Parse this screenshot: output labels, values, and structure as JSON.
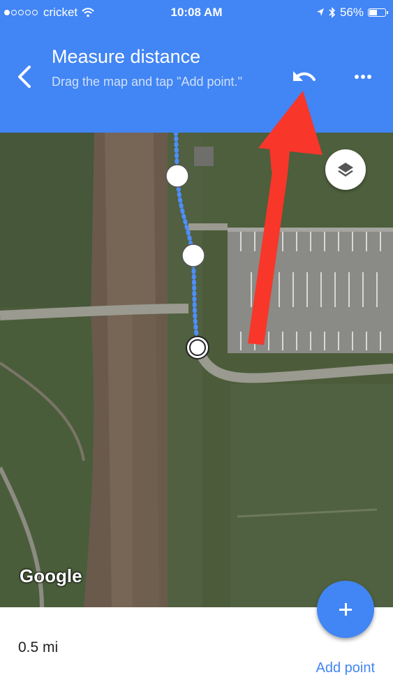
{
  "status_bar": {
    "carrier": "cricket",
    "time": "10:08 AM",
    "battery": "56%",
    "battery_level": 0.56,
    "signal_bars": 1,
    "icons": [
      "wifi-icon",
      "location-icon",
      "bluetooth-icon",
      "battery-icon"
    ]
  },
  "header": {
    "title": "Measure distance",
    "subtitle": "Drag the map and tap \"Add point.\"",
    "icons": [
      "back-arrow-icon",
      "undo-icon",
      "more-icon"
    ]
  },
  "map": {
    "attribution": "Google",
    "layers_icon": "layers-icon"
  },
  "bottom": {
    "distance": "0.5 mi",
    "add_point_label": "Add point",
    "fab_icon": "plus-icon"
  },
  "colors": {
    "primary": "#4285f4",
    "white": "#ffffff",
    "annotation_arrow": "#f8362a"
  }
}
